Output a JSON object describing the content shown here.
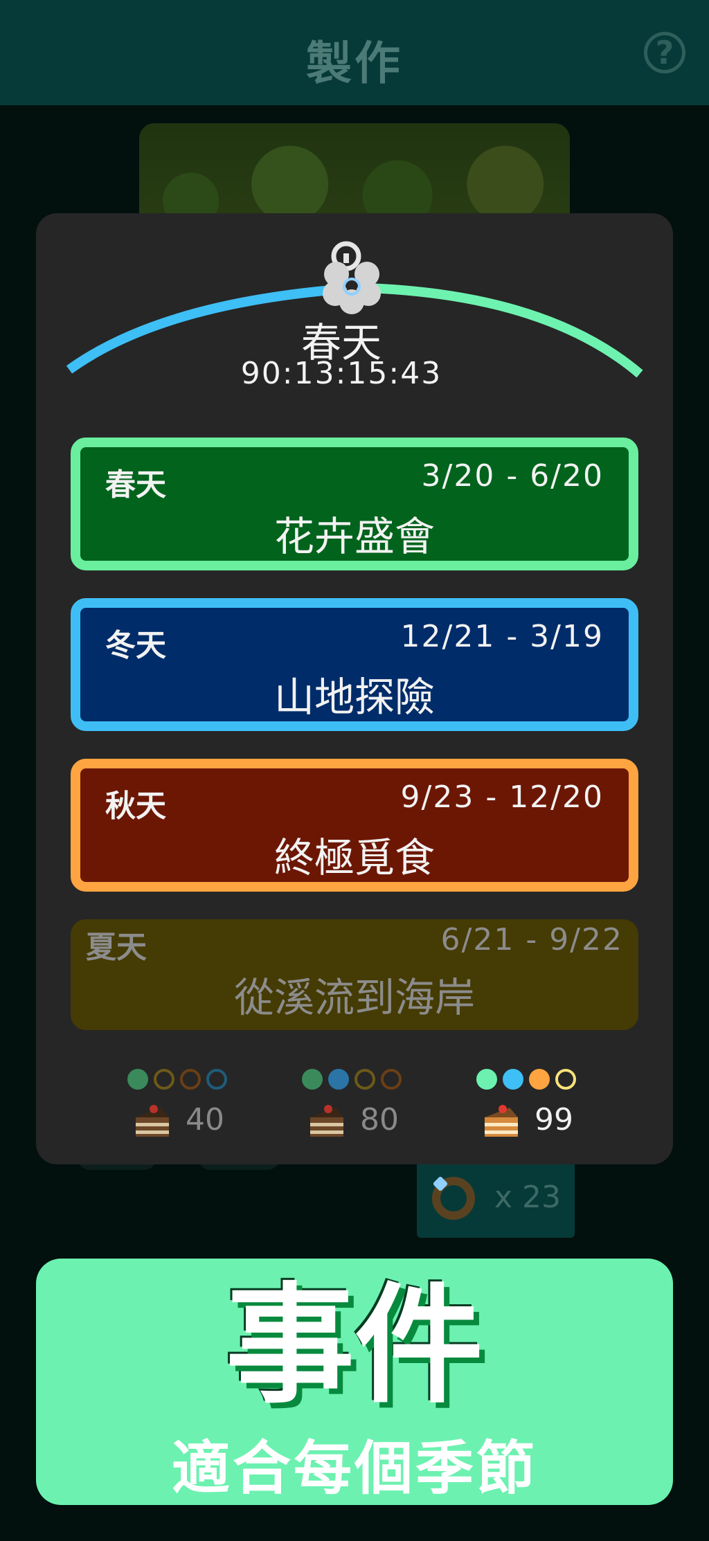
{
  "header": {
    "title": "製作",
    "help_icon": "question-circle-icon"
  },
  "background_item": {
    "icon": "ring-icon",
    "quantity": "x 23"
  },
  "season_indicator": {
    "current_season": "春天",
    "countdown": "90:13:15:43",
    "icon": "flower-lock-icon",
    "arc_colors": {
      "left": "#3ebff6",
      "right": "#6ef2b0"
    }
  },
  "events": [
    {
      "season": "春天",
      "dates": "3/20 - 6/20",
      "name": "花卉盛會",
      "fill": "#02631c",
      "border": "#69ef9d"
    },
    {
      "season": "冬天",
      "dates": "12/21 - 3/19",
      "name": "山地探險",
      "fill": "#002c69",
      "border": "#3fbef6"
    },
    {
      "season": "秋天",
      "dates": "9/23 - 12/20",
      "name": "終極覓食",
      "fill": "#6c1704",
      "border": "#fea440"
    },
    {
      "season": "夏天",
      "dates": "6/21 - 9/22",
      "name": "從溪流到海岸",
      "fill": "#453b04",
      "locked": true
    }
  ],
  "reward_tiers": [
    {
      "dots": [
        "filled:#3a8a5c",
        "ring:#6d5a18",
        "ring:#6b3e16",
        "ring:#1f5c7a"
      ],
      "reward_icon": "cake-icon",
      "amount": "40",
      "text_color": "#8a8a8a"
    },
    {
      "dots": [
        "filled:#3a8a5c",
        "filled:#2a75a6",
        "ring:#6d5a18",
        "ring:#6b3e16"
      ],
      "reward_icon": "cake-icon",
      "amount": "80",
      "text_color": "#8a8a8a"
    },
    {
      "dots": [
        "filled:#6cf1b0",
        "filled:#3ebff6",
        "filled:#fea440",
        "ring:#f5e27a"
      ],
      "reward_icon": "cake-icon",
      "amount": "99",
      "text_color": "#f2f2f2"
    }
  ],
  "banner": {
    "title": "事件",
    "subtitle": "適合每個季節",
    "color": "#6cf1b0"
  }
}
